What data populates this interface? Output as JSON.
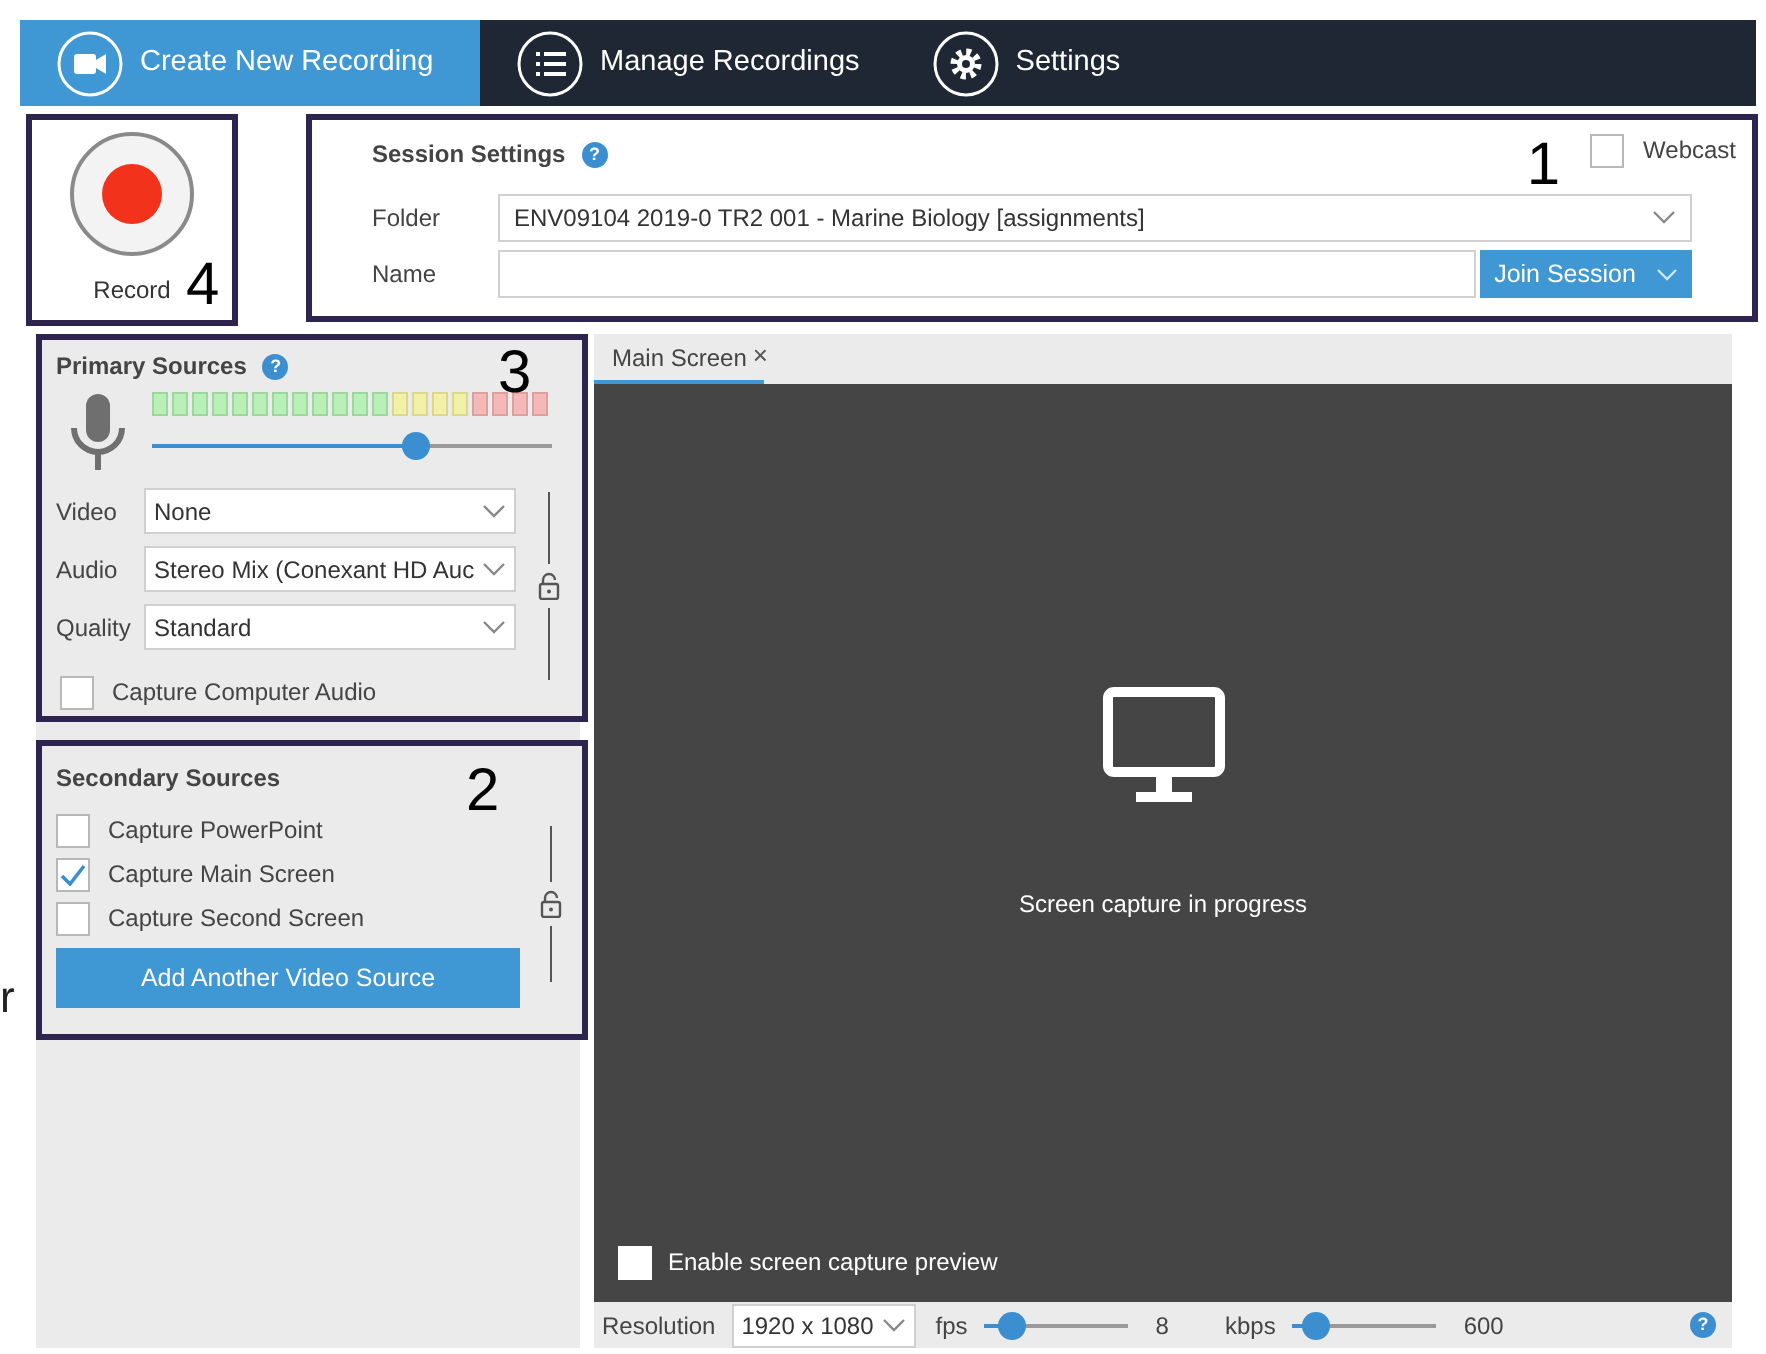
{
  "tabs": [
    {
      "label": "Create New Recording",
      "selected": true
    },
    {
      "label": "Manage Recordings",
      "selected": false
    },
    {
      "label": "Settings",
      "selected": false
    }
  ],
  "help_mark": "?",
  "record": {
    "label": "Record",
    "callout": "4"
  },
  "session_settings": {
    "title": "Session Settings",
    "callout": "1",
    "webcast": {
      "label": "Webcast",
      "checked": false
    },
    "folder": {
      "label": "Folder",
      "value": "ENV09104 2019-0 TR2 001 - Marine Biology [assignments]"
    },
    "name": {
      "label": "Name"
    },
    "join_button": "Join Session"
  },
  "primary_sources": {
    "title": "Primary Sources",
    "callout": "3",
    "mic_volume": {
      "level": 0.66
    },
    "fields": [
      {
        "label": "Video",
        "value": "None"
      },
      {
        "label": "Audio",
        "value": "Stereo Mix (Conexant HD Auc"
      },
      {
        "label": "Quality",
        "value": "Standard"
      }
    ],
    "capture_audio": {
      "label": "Capture Computer Audio",
      "checked": false
    }
  },
  "secondary_sources": {
    "title": "Secondary Sources",
    "callout": "2",
    "options": [
      {
        "label": "Capture PowerPoint",
        "checked": false
      },
      {
        "label": "Capture Main Screen",
        "checked": true
      },
      {
        "label": "Capture Second Screen",
        "checked": false
      }
    ],
    "add_button": "Add Another Video Source"
  },
  "preview": {
    "tabs": [
      {
        "label": "Main Screen",
        "selected": true,
        "close": "×"
      }
    ],
    "message": "Screen capture in progress",
    "enable_preview": {
      "label": "Enable screen capture preview",
      "checked": false
    }
  },
  "bottom_bar": {
    "resolution": {
      "label": "Resolution",
      "value": "1920 x 1080"
    },
    "fps": {
      "label": "fps",
      "level": 0.2,
      "reading": "8"
    },
    "kbps": {
      "label": "kbps",
      "level": 0.17,
      "reading": "600"
    }
  },
  "stray_text": "r"
}
